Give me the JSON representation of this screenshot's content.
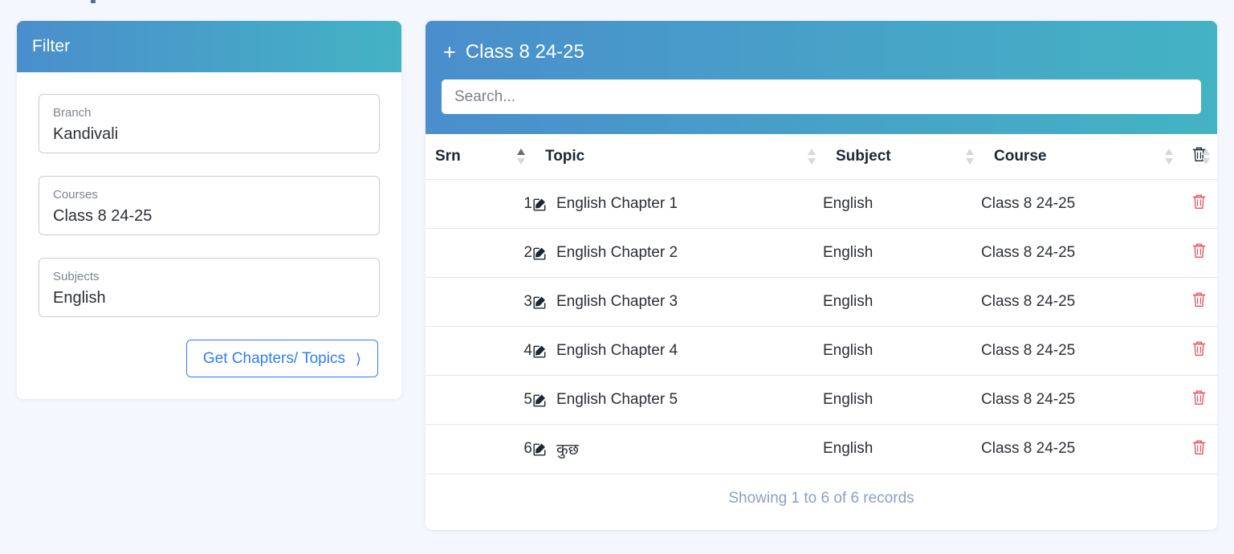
{
  "page": {
    "background": "#f4f7fd",
    "accent_gradient_start": "#4a8ecd",
    "accent_gradient_end": "#44b3c3",
    "link_blue": "#2c7ef8",
    "muted_text": "#9aa0a9",
    "footer_text_color": "#8ba0c4",
    "delete_icon_color": "#e8505b"
  },
  "filter": {
    "title": "Filter",
    "fields": [
      {
        "label": "Branch",
        "value": "Kandivali",
        "name": "branch"
      },
      {
        "label": "Courses",
        "value": "Class 8 24-25",
        "name": "courses"
      },
      {
        "label": "Subjects",
        "value": "English",
        "name": "subjects"
      }
    ],
    "submit_label": "Get Chapters/ Topics",
    "submit_chevron": "⟩"
  },
  "table_panel": {
    "title": "Class 8 24-25",
    "add_icon": "+",
    "search": {
      "value": "",
      "placeholder": "Search..."
    },
    "columns": [
      {
        "key": "srn",
        "label": "Srn",
        "sortable": true,
        "sort": "asc"
      },
      {
        "key": "topic",
        "label": "Topic",
        "sortable": true,
        "sort": "none"
      },
      {
        "key": "subject",
        "label": "Subject",
        "sortable": true,
        "sort": "none"
      },
      {
        "key": "course",
        "label": "Course",
        "sortable": true,
        "sort": "none"
      },
      {
        "key": "delete",
        "label": "",
        "sortable": true,
        "sort": "none",
        "icon": "trash-icon"
      }
    ],
    "rows": [
      {
        "srn": "1",
        "topic": "English Chapter 1",
        "subject": "English",
        "course": "Class 8 24-25"
      },
      {
        "srn": "2",
        "topic": "English Chapter 2",
        "subject": "English",
        "course": "Class 8 24-25"
      },
      {
        "srn": "3",
        "topic": "English Chapter 3",
        "subject": "English",
        "course": "Class 8 24-25"
      },
      {
        "srn": "4",
        "topic": "English Chapter 4",
        "subject": "English",
        "course": "Class 8 24-25"
      },
      {
        "srn": "5",
        "topic": "English Chapter 5",
        "subject": "English",
        "course": "Class 8 24-25"
      },
      {
        "srn": "6",
        "topic": "कुछ",
        "subject": "English",
        "course": "Class 8 24-25"
      }
    ],
    "footer_text": "Showing 1 to 6 of 6 records"
  }
}
